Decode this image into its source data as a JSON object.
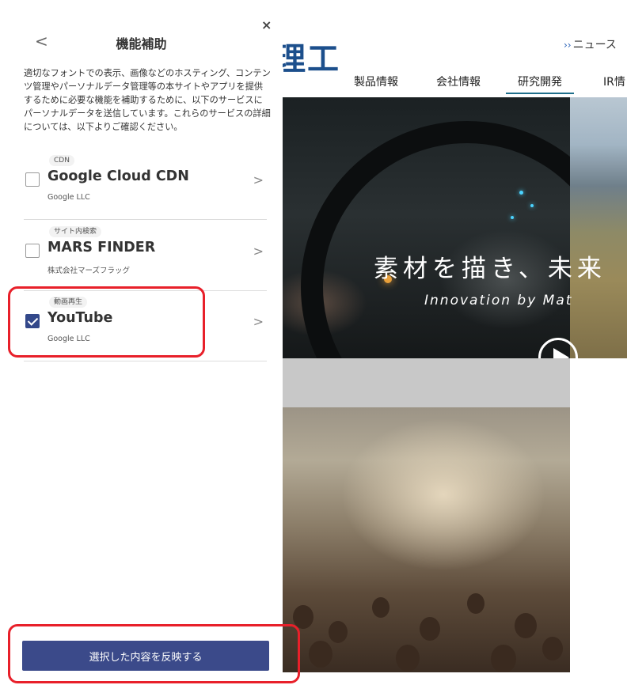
{
  "site": {
    "logo_text": "理工",
    "news_link": "ニュース",
    "nav": [
      "製品情報",
      "会社情報",
      "研究開発",
      "IR情"
    ],
    "hero_headline": "素材を描き、未来",
    "hero_sub": "Innovation by Mat"
  },
  "panel": {
    "title": "機能補助",
    "back_glyph": "<",
    "close_glyph": "×",
    "description": "適切なフォントでの表示、画像などのホスティング、コンテンツ管理やパーソナルデータ管理等の本サイトやアプリを提供するために必要な機能を補助するために、以下のサービスにパーソナルデータを送信しています。これらのサービスの詳細については、以下よりご確認ください。",
    "services": [
      {
        "category": "CDN",
        "name": "Google Cloud CDN",
        "owner": "Google LLC",
        "checked": false
      },
      {
        "category": "サイト内検索",
        "name": "MARS FINDER",
        "owner": "株式会社マーズフラッグ",
        "checked": false
      },
      {
        "category": "動画再生",
        "name": "YouTube",
        "owner": "Google LLC",
        "checked": true
      }
    ],
    "apply_button": "選択した内容を反映する"
  },
  "colors": {
    "accent": "#3b4a8a",
    "highlight": "#e8202a",
    "logo": "#1c4f8c"
  }
}
